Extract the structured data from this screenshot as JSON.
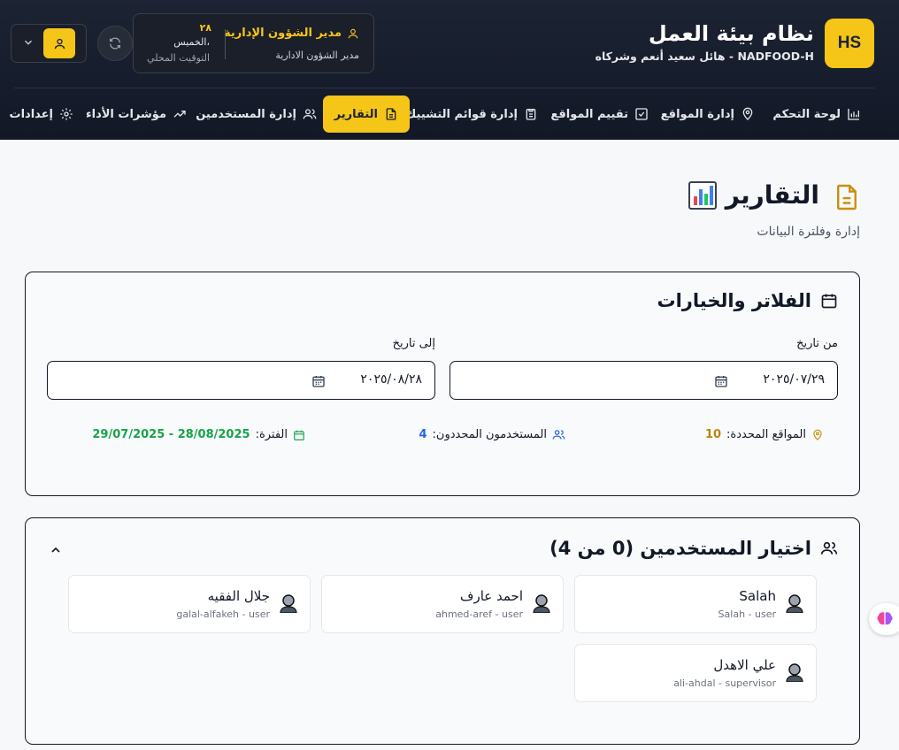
{
  "header": {
    "logo_text": "HS",
    "title": "نظام بيئة العمل",
    "subtitle": "NADFOOD-H - هائل سعيد أنعم وشركاه",
    "user_role": "مدير الشؤون الإدارية",
    "user_name": "مدير الشؤون الادارية",
    "day_number": "٢٨",
    "day_name": "الخميس،",
    "timezone_label": "التوقيت المحلي",
    "icons": {
      "refresh": "refresh-icon",
      "user": "user-icon",
      "chevron": "chevron-down-icon"
    }
  },
  "nav": [
    {
      "label": "لوحة التحكم",
      "icon": "bar-chart-icon"
    },
    {
      "label": "إدارة المواقع",
      "icon": "map-pin-icon"
    },
    {
      "label": "تقييم المواقع",
      "icon": "check-square-icon"
    },
    {
      "label": "إدارة قوائم التشييك",
      "icon": "clipboard-icon"
    },
    {
      "label": "التقارير",
      "icon": "file-text-icon",
      "active": true
    },
    {
      "label": "إدارة المستخدمين",
      "icon": "users-icon"
    },
    {
      "label": "مؤشرات الأداء",
      "icon": "trending-up-icon"
    },
    {
      "label": "إعدادات",
      "icon": "gear-icon"
    }
  ],
  "page": {
    "title": "التقارير",
    "subtitle": "إدارة وفلترة البيانات"
  },
  "filters": {
    "title": "الفلاتر والخيارات",
    "from_label": "من تاريخ",
    "from_value": "٢٠٢٥/٠٧/٢٩",
    "to_label": "إلى تاريخ",
    "to_value": "٢٠٢٥/٠٨/٢٨",
    "sites_label": "المواقع المحددة:",
    "sites_count": "10",
    "users_label": "المستخدمون المحددون:",
    "users_count": "4",
    "period_label": "الفترة:",
    "period_value": "29/07/2025 - 28/08/2025"
  },
  "users_section": {
    "title": "اختيار المستخدمين (0 من 4)",
    "users": [
      {
        "name": "Salah",
        "handle": "Salah - user"
      },
      {
        "name": "احمد عارف",
        "handle": "ahmed-aref - user"
      },
      {
        "name": "جلال الفقيه",
        "handle": "galal-alfakeh - user"
      },
      {
        "name": "علي الاهدل",
        "handle": "ali-ahdal - supervisor"
      }
    ]
  },
  "colors": {
    "accent": "#f5c518",
    "header_bg": "#161c28",
    "sites_count": "#b8860b",
    "users_count": "#2563eb",
    "period": "#16a34a"
  }
}
